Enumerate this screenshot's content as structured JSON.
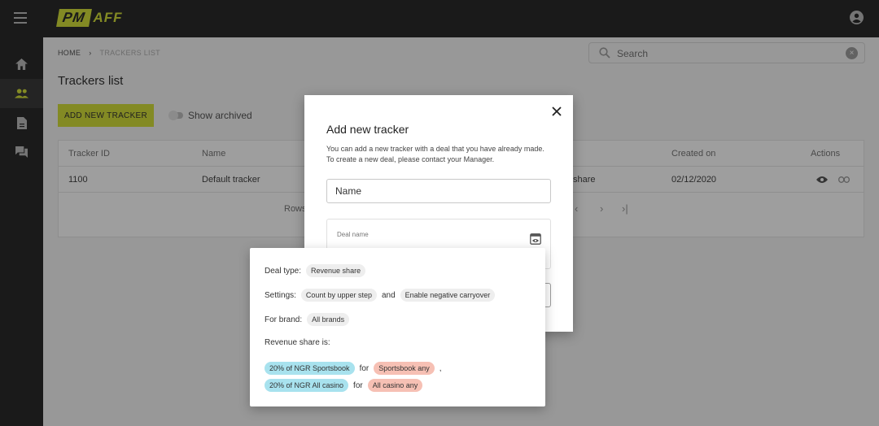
{
  "app": {
    "logo_left": "PM",
    "logo_right": "AFF"
  },
  "breadcrumb": {
    "home": "HOME",
    "current": "TRACKERS LIST"
  },
  "search": {
    "placeholder": "Search"
  },
  "page": {
    "title": "Trackers list",
    "add_button": "ADD NEW TRACKER",
    "show_archived": "Show archived"
  },
  "table": {
    "headers": [
      "Tracker ID",
      "Name",
      "",
      "Created on",
      "Actions"
    ],
    "row": {
      "id": "1100",
      "name": "Default tracker",
      "deal_fragment": "share",
      "created": "02/12/2020"
    },
    "pager_label": "Rows"
  },
  "modal": {
    "title": "Add new tracker",
    "description_line1": "You can add a new tracker with a deal that you have already made.",
    "description_line2": "To create a new deal, please contact your Manager.",
    "name_value": "Name",
    "deal_label": "Deal name"
  },
  "popover": {
    "deal_type_label": "Deal type:",
    "deal_type_value": "Revenue share",
    "settings_label": "Settings:",
    "setting_1": "Count by upper step",
    "and_text": "and",
    "setting_2": "Enable negative carryover",
    "brand_label": "For brand:",
    "brand_value": "All brands",
    "revshare_label": "Revenue share is:",
    "row1_share": "20% of NGR Sportsbook",
    "for_text": "for",
    "row1_target": "Sportsbook any",
    "comma": ",",
    "row2_share": "20% of NGR All casino",
    "row2_target": "All casino any"
  },
  "colors": {
    "accent": "#d4df3a",
    "chip_blue": "#a8e2ee",
    "chip_red": "#f6c0b4"
  }
}
